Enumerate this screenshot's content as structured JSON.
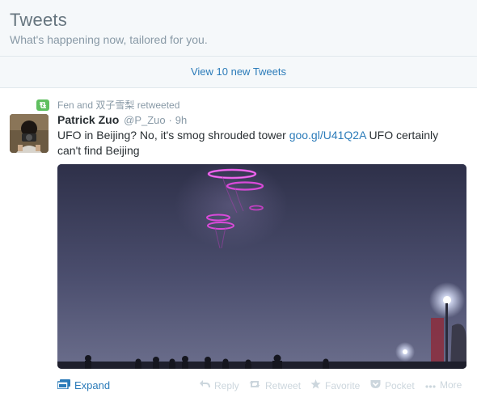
{
  "header": {
    "title": "Tweets",
    "subtitle": "What's happening now, tailored for you."
  },
  "new_tweets_bar": {
    "label": "View 10 new Tweets"
  },
  "tweet": {
    "context": "Fen and 双子雪梨 retweeted",
    "fullname": "Patrick Zuo",
    "username": "@P_Zuo",
    "separator": "·",
    "time": "9h",
    "text_before_link": "UFO in Beijing? No, it's smog shrouded tower ",
    "link": "goo.gl/U41Q2A",
    "text_after_link": " UFO certainly can't find Beijing",
    "actions": {
      "expand": "Expand",
      "reply": "Reply",
      "retweet": "Retweet",
      "favorite": "Favorite",
      "pocket": "Pocket",
      "more": "More"
    }
  },
  "icons": {
    "retweet_badge": "retweet-icon",
    "expand": "photo-icon",
    "reply": "reply-arrow-icon",
    "retweet": "retweet-icon",
    "favorite": "star-icon",
    "pocket": "pocket-icon",
    "more": "ellipsis-icon"
  },
  "colors": {
    "link": "#2b7bb9",
    "muted": "#8899a6",
    "action_gray": "#ccd6dd",
    "retweet_green": "#5fbf5f",
    "header_bg": "#f5f8fa"
  }
}
